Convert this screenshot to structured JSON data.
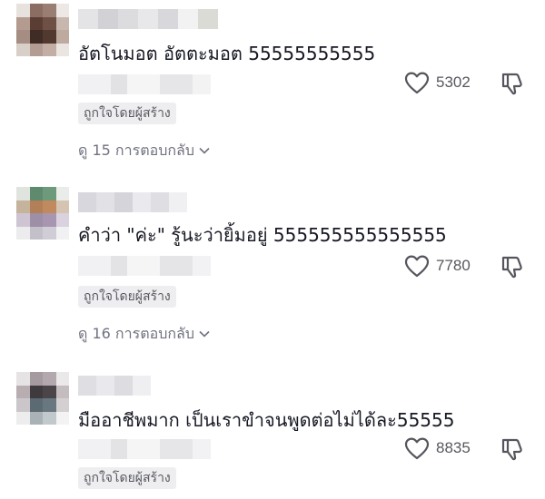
{
  "comments": [
    {
      "text": "อัตโนมอต อัตตะมอต 55555555555",
      "likes": "5302",
      "creator_badge": "ถูกใจโดยผู้สร้าง",
      "replies_label": "ดู 15 การตอบกลับ"
    },
    {
      "text": "คำว่า \"ค่ะ\" รู้นะว่ายิ้มอยู่ 555555555555555",
      "likes": "7780",
      "creator_badge": "ถูกใจโดยผู้สร้าง",
      "replies_label": "ดู 16 การตอบกลับ"
    },
    {
      "text": "มืออาชีพมาก เป็นเราขำจนพูดต่อไม่ได้ละ55555",
      "likes": "8835",
      "creator_badge": "ถูกใจโดยผู้สร้าง"
    }
  ],
  "icons": {
    "like": "heart-outline-icon",
    "dislike": "thumbs-down-outline-icon",
    "expand": "chevron-down-icon"
  },
  "colors": {
    "text_primary": "#161823",
    "text_secondary": "#57585f",
    "badge_bg": "#eeeef0",
    "muted": "#707280"
  }
}
